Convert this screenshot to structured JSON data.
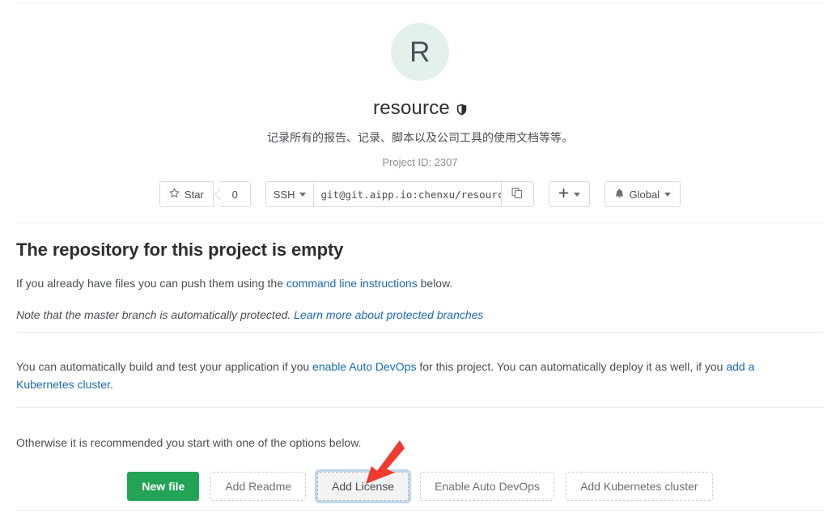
{
  "project": {
    "avatar_letter": "R",
    "name": "resource",
    "visibility_icon": "shield-private-icon",
    "description": "记录所有的报告、记录、脚本以及公司工具的使用文档等等。",
    "project_id_label": "Project ID: 2307"
  },
  "actions": {
    "star_icon": "star-outline-icon",
    "star_label": "Star",
    "star_count": "0",
    "clone_protocol": "SSH",
    "clone_url": "git@git.aipp.io:chenxu/resource.g",
    "copy_icon": "copy-icon",
    "plus_icon": "plus-icon",
    "notification_icon": "bell-icon",
    "notification_label": "Global"
  },
  "empty_state": {
    "title": "The repository for this project is empty",
    "push_text_before": "If you already have files you can push them using the ",
    "push_link": "command line instructions",
    "push_text_after": " below.",
    "note_text_before": "Note that the master branch is automatically protected. ",
    "note_link": "Learn more about protected branches",
    "devops_text_1": "You can automatically build and test your application if you ",
    "devops_link_1": "enable Auto DevOps",
    "devops_text_2": " for this project. You can automatically deploy it as well, if you ",
    "devops_link_2": "add a Kubernetes cluster",
    "devops_text_3": ".",
    "otherwise_text": "Otherwise it is recommended you start with one of the options below."
  },
  "options": {
    "new_file": "New file",
    "add_readme": "Add Readme",
    "add_license": "Add License",
    "enable_auto_devops": "Enable Auto DevOps",
    "add_kubernetes_cluster": "Add Kubernetes cluster"
  },
  "annotation": {
    "arrow_icon": "red-arrow-pointer",
    "arrow_color": "#ef3b2d"
  },
  "colors": {
    "primary_green": "#22a355",
    "link_blue": "#1b69b6",
    "avatar_bg": "#e3f0ec",
    "focus_ring": "rgba(66,139,202,0.35)"
  }
}
